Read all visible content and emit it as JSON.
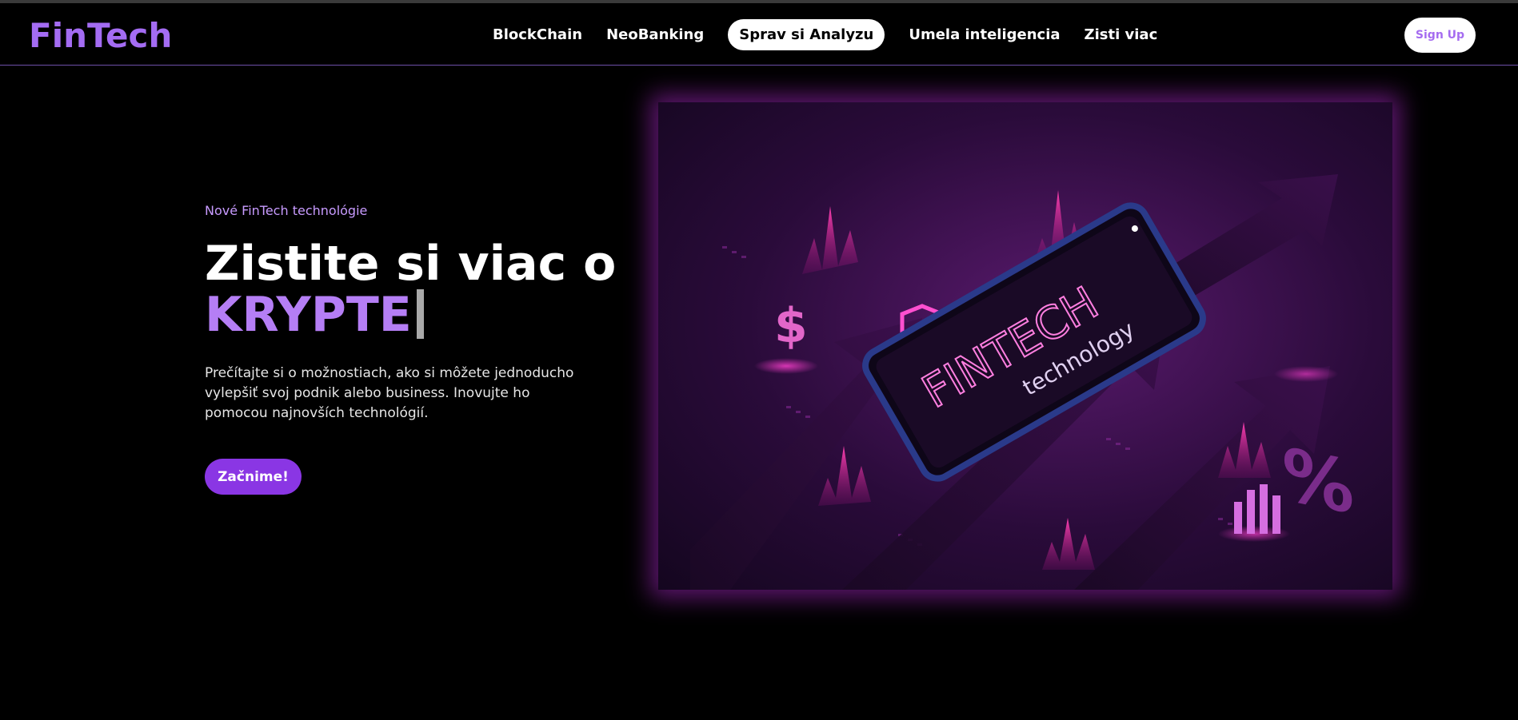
{
  "brand": {
    "logo": "FinTech"
  },
  "nav": {
    "items": [
      {
        "label": "BlockChain"
      },
      {
        "label": "NeoBanking"
      },
      {
        "label": "Sprav si Analyzu",
        "active": true
      },
      {
        "label": "Umela inteligencia"
      },
      {
        "label": "Zisti viac"
      }
    ],
    "signup_label": "Sign Up"
  },
  "hero": {
    "eyebrow": "Nové FinTech technológie",
    "title_line1": "Zistite si viac o",
    "title_line2": "KRYPTE",
    "description": "Prečítajte si o možnostiach, ako si môžete jednoducho vylepšiť svoj podnik alebo business. Inovujte ho pomocou najnovších technológií.",
    "cta_label": "Začnime!"
  },
  "illustration": {
    "phone_text": "FINTECH",
    "phone_subtext": "technology"
  },
  "colors": {
    "accent": "#a46cf3",
    "cta": "#8a36e4",
    "glow": "#c21fbf"
  }
}
